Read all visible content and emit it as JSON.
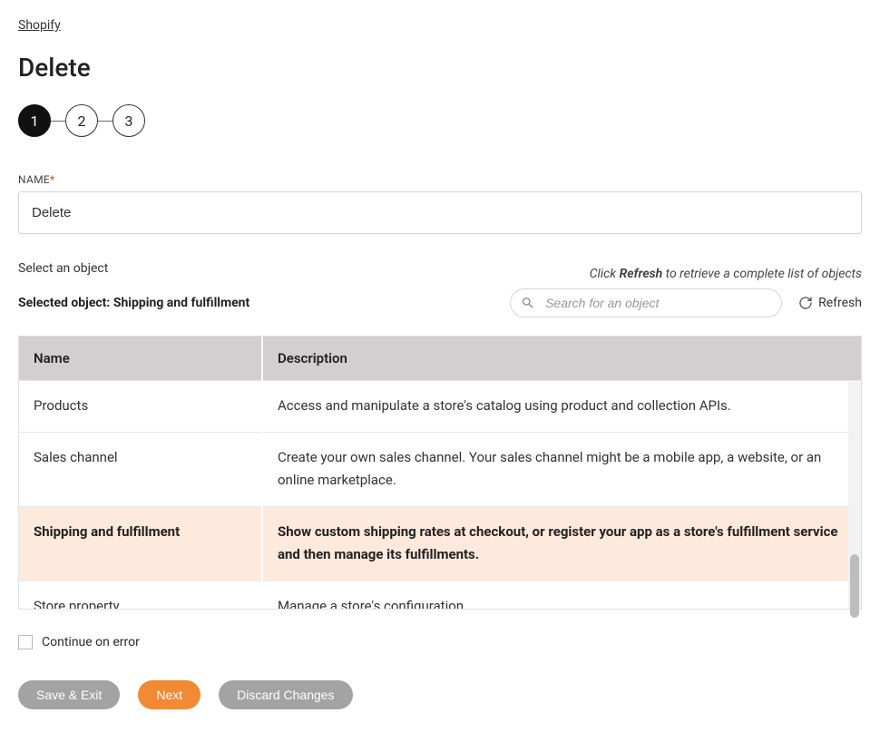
{
  "breadcrumb": "Shopify",
  "page_title": "Delete",
  "stepper": {
    "steps": [
      "1",
      "2",
      "3"
    ],
    "active_index": 0
  },
  "name_field": {
    "label": "NAME",
    "value": "Delete"
  },
  "select": {
    "label": "Select an object",
    "helper_prefix": "Click ",
    "helper_bold": "Refresh",
    "helper_suffix": " to retrieve a complete list of objects",
    "selected_prefix": "Selected object: ",
    "selected_value": "Shipping and fulfillment"
  },
  "search": {
    "placeholder": "Search for an object"
  },
  "refresh_label": "Refresh",
  "table": {
    "headers": {
      "name": "Name",
      "description": "Description"
    },
    "rows": [
      {
        "name": "Products",
        "description": "Access and manipulate a store's catalog using product and collection APIs.",
        "selected": false
      },
      {
        "name": "Sales channel",
        "description": "Create your own sales channel. Your sales channel might be a mobile app, a website, or an online marketplace.",
        "selected": false
      },
      {
        "name": "Shipping and fulfillment",
        "description": "Show custom shipping rates at checkout, or register your app as a store's fulfillment service and then manage its fulfillments.",
        "selected": true
      },
      {
        "name": "Store property",
        "description": "Manage a store's configuration.",
        "selected": false
      }
    ]
  },
  "continue_on_error": "Continue on error",
  "buttons": {
    "save_exit": "Save & Exit",
    "next": "Next",
    "discard": "Discard Changes"
  }
}
